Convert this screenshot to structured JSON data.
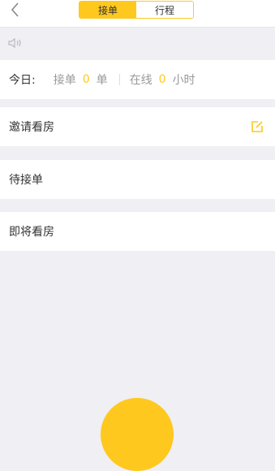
{
  "header": {
    "tabs": [
      {
        "label": "接单",
        "active": true
      },
      {
        "label": "行程",
        "active": false
      }
    ]
  },
  "stats": {
    "today_label": "今日:",
    "orders_label": "接单",
    "orders_value": "0",
    "orders_unit": "单",
    "online_label": "在线",
    "online_value": "0",
    "online_unit": "小时"
  },
  "rows": [
    {
      "label": "邀请看房"
    },
    {
      "label": "待接单"
    },
    {
      "label": "即将看房"
    }
  ],
  "icons": {
    "back": "chevron-left-icon",
    "speaker": "speaker-icon",
    "edit": "edit-icon"
  },
  "colors": {
    "accent": "#ffc81e",
    "background": "#efeff4"
  }
}
